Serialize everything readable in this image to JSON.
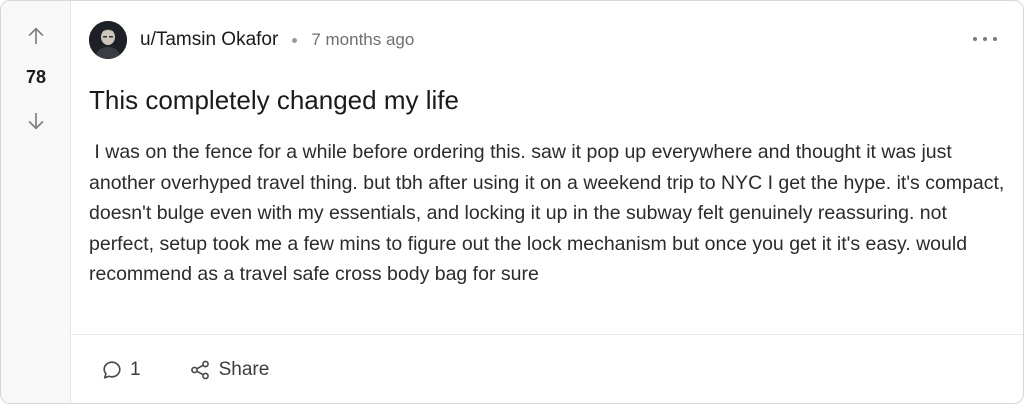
{
  "post": {
    "score": "78",
    "author": "u/Tamsin Okafor",
    "timestamp": "7 months ago",
    "title": "This completely changed my life",
    "body": " I was on the fence for a while before ordering this. saw it pop up everywhere and thought it was just another overhyped travel thing. but tbh after using it on a weekend trip to NYC I get the hype. it's compact, doesn't bulge even with my essentials, and locking it up in the subway felt genuinely reassuring. not perfect, setup took me a few mins to figure out the lock mechanism but once you get it it's easy. would recommend as a travel safe cross body bag for sure",
    "comment_count": "1",
    "share_label": "Share"
  },
  "icons": {
    "upvote": "arrow-up-icon",
    "downvote": "arrow-down-icon",
    "more": "more-options-icon",
    "comment": "comment-bubble-icon",
    "share": "share-icon",
    "avatar": "user-avatar"
  },
  "colors": {
    "vote_column_bg": "#f8f8f8",
    "text_primary": "#1a1a1b",
    "text_muted": "#6f6f6f",
    "border": "#d7d7d7"
  }
}
